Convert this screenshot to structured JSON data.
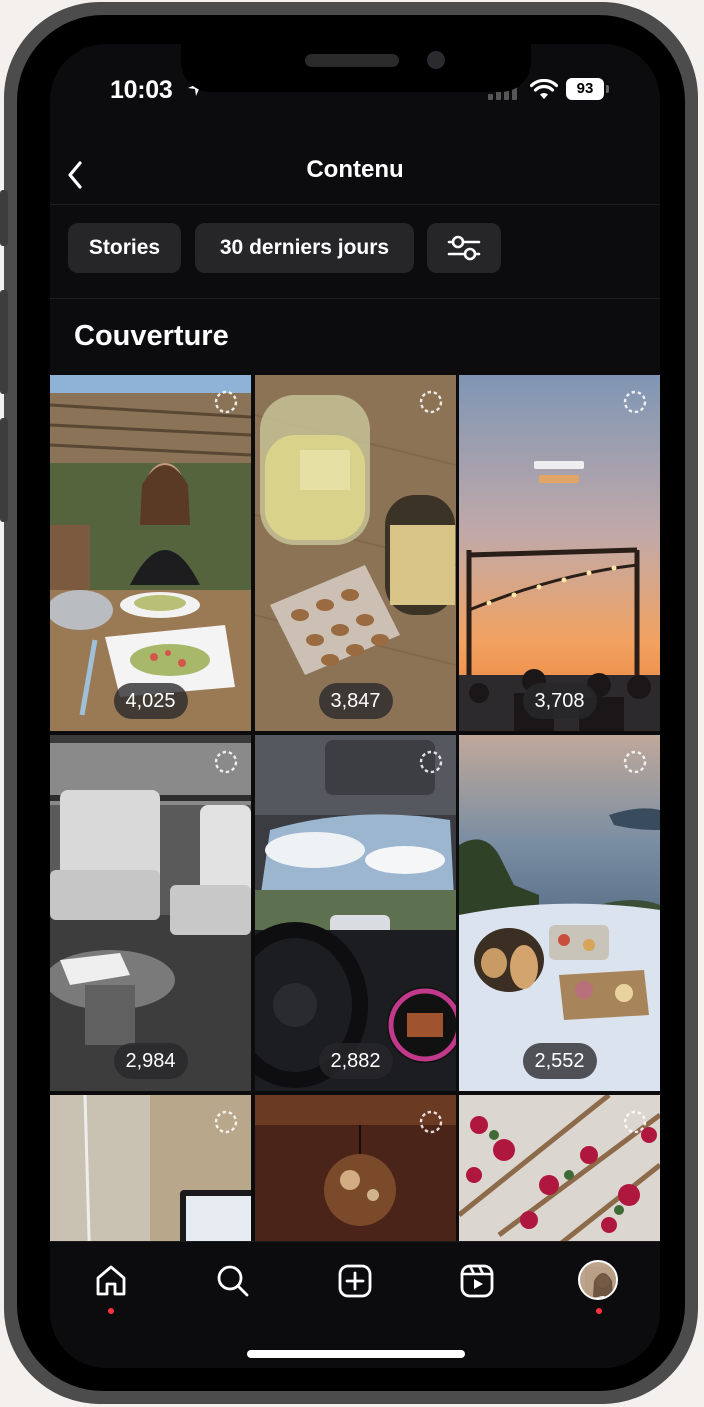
{
  "status_bar": {
    "time": "10:03",
    "battery": "93"
  },
  "header": {
    "title": "Contenu"
  },
  "filters": {
    "stories": "Stories",
    "period": "30 derniers jours"
  },
  "section": {
    "title": "Couverture"
  },
  "tiles": [
    {
      "count": "4,025"
    },
    {
      "count": "3,847"
    },
    {
      "count": "3,708"
    },
    {
      "count": "2,984"
    },
    {
      "count": "2,882"
    },
    {
      "count": "2,552"
    },
    {
      "count": ""
    },
    {
      "count": ""
    },
    {
      "count": ""
    }
  ],
  "icons": [
    "back-arrow-icon",
    "filter-sliders-icon",
    "home-icon",
    "search-icon",
    "create-icon",
    "reels-icon",
    "profile-avatar-icon",
    "location-arrow-icon",
    "signal-icon",
    "wifi-icon",
    "battery-icon",
    "loading-spinner-icon"
  ],
  "colors": {
    "background": "#0c0c0e",
    "chip": "#262628",
    "notification_dot": "#ff3040",
    "frame": "#4c4c4c"
  }
}
